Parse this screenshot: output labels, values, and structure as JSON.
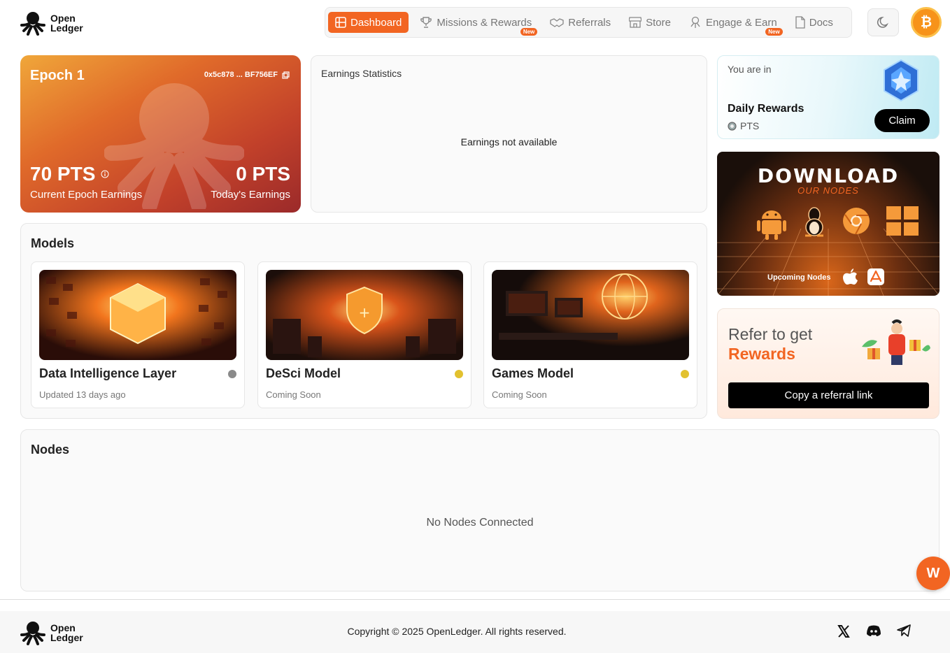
{
  "header": {
    "logo_line1": "Open",
    "logo_line2": "Ledger",
    "nav": [
      {
        "label": "Dashboard",
        "icon": "grid-icon",
        "active": true
      },
      {
        "label": "Missions & Rewards",
        "icon": "trophy-icon",
        "badge": "New"
      },
      {
        "label": "Referrals",
        "icon": "handshake-icon"
      },
      {
        "label": "Store",
        "icon": "store-icon"
      },
      {
        "label": "Engage & Earn",
        "icon": "octopus-icon",
        "badge": "New"
      },
      {
        "label": "Docs",
        "icon": "document-icon"
      }
    ],
    "theme_icon": "moon-icon",
    "avatar_glyph": "₿"
  },
  "epoch": {
    "title": "Epoch 1",
    "address": "0x5c878 ... BF756EF",
    "current_pts": "70 PTS",
    "current_label": "Current Epoch Earnings",
    "today_pts": "0 PTS",
    "today_label": "Today's Earnings"
  },
  "earnings": {
    "title": "Earnings Statistics",
    "empty": "Earnings not available"
  },
  "models": {
    "title": "Models",
    "items": [
      {
        "name": "Data Intelligence Layer",
        "status": "Updated 13 days ago",
        "dot_color": "#8a8a8a"
      },
      {
        "name": "DeSci Model",
        "status": "Coming Soon",
        "dot_color": "#e2c12f"
      },
      {
        "name": "Games Model",
        "status": "Coming Soon",
        "dot_color": "#e2c12f"
      }
    ]
  },
  "nodes": {
    "title": "Nodes",
    "empty": "No Nodes Connected"
  },
  "daily": {
    "pre": "You are in",
    "title": "Daily Rewards",
    "pts": "PTS",
    "claim": "Claim"
  },
  "download": {
    "title": "DOWNLOAD",
    "subtitle": "OUR NODES",
    "upcoming": "Upcoming Nodes"
  },
  "refer": {
    "line1": "Refer to get",
    "line2": "Rewards",
    "button": "Copy a referral link"
  },
  "fab": "W",
  "footer": {
    "copyright": "Copyright © 2025 OpenLedger. All rights reserved."
  },
  "colors": {
    "accent": "#f26522",
    "nav_bg": "#f6f6f6"
  }
}
